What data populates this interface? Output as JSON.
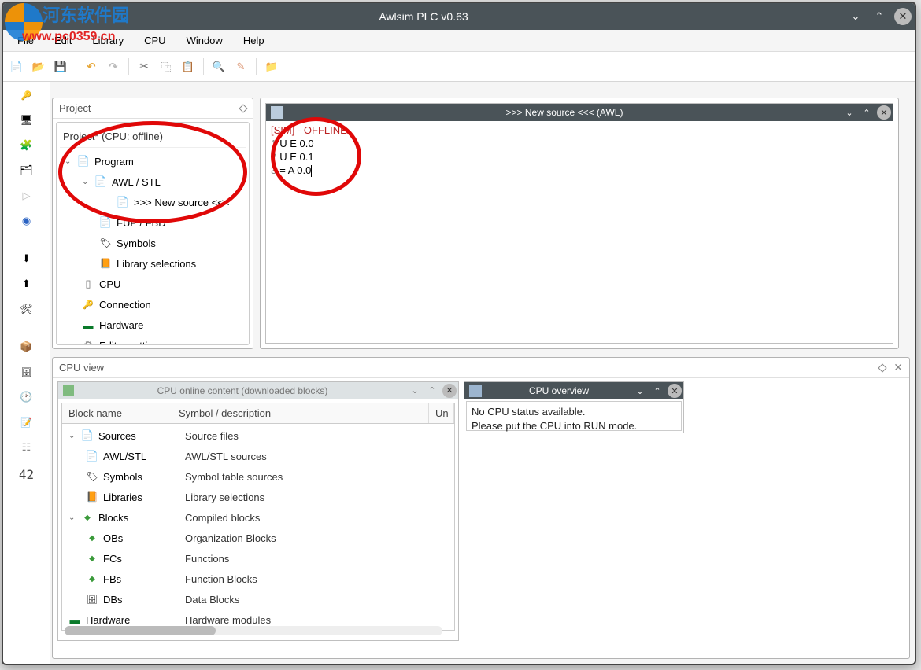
{
  "watermark": {
    "brand": "河东软件园",
    "url": "www.pc0359.cn"
  },
  "window": {
    "title": "Awlsim PLC v0.63"
  },
  "menu": {
    "file": "File",
    "edit": "Edit",
    "library": "Library",
    "cpu": "CPU",
    "window": "Window",
    "help": "Help"
  },
  "leftdock": {
    "counter": "42"
  },
  "project": {
    "panel_title": "Project",
    "root": "Project* (CPU: offline)",
    "items": {
      "program": "Program",
      "awlstl": "AWL / STL",
      "newsource": ">>> New source <<<",
      "fupfbd": "FUP / FBD",
      "symbols": "Symbols",
      "library": "Library selections",
      "cpu": "CPU",
      "connection": "Connection",
      "hardware": "Hardware",
      "editor": "Editor settings"
    }
  },
  "editor": {
    "tab_title": ">>> New source <<< (AWL)",
    "sim_label": "[SIM] - OFFLINE",
    "lines": {
      "l1": "U E 0.0",
      "l2": "U E 0.1",
      "l3": "= A 0.0"
    },
    "num": {
      "n1": "1",
      "n2": "2",
      "n3": "3"
    }
  },
  "cpuview": {
    "panel_title": "CPU view",
    "online_title": "CPU online content (downloaded blocks)",
    "headers": {
      "block": "Block name",
      "desc": "Symbol / description",
      "un": "Un"
    },
    "rows": {
      "sources": {
        "name": "Sources",
        "desc": "Source files"
      },
      "awlstl": {
        "name": "AWL/STL",
        "desc": "AWL/STL sources"
      },
      "symbols": {
        "name": "Symbols",
        "desc": "Symbol table sources"
      },
      "libraries": {
        "name": "Libraries",
        "desc": "Library selections"
      },
      "blocks": {
        "name": "Blocks",
        "desc": "Compiled blocks"
      },
      "obs": {
        "name": "OBs",
        "desc": "Organization Blocks"
      },
      "fcs": {
        "name": "FCs",
        "desc": "Functions"
      },
      "fbs": {
        "name": "FBs",
        "desc": "Function Blocks"
      },
      "dbs": {
        "name": "DBs",
        "desc": "Data Blocks"
      },
      "hardware": {
        "name": "Hardware",
        "desc": "Hardware modules"
      }
    },
    "overview_title": "CPU overview",
    "overview_msg1": "No CPU status available.",
    "overview_msg2": "Please put the CPU into RUN mode."
  }
}
